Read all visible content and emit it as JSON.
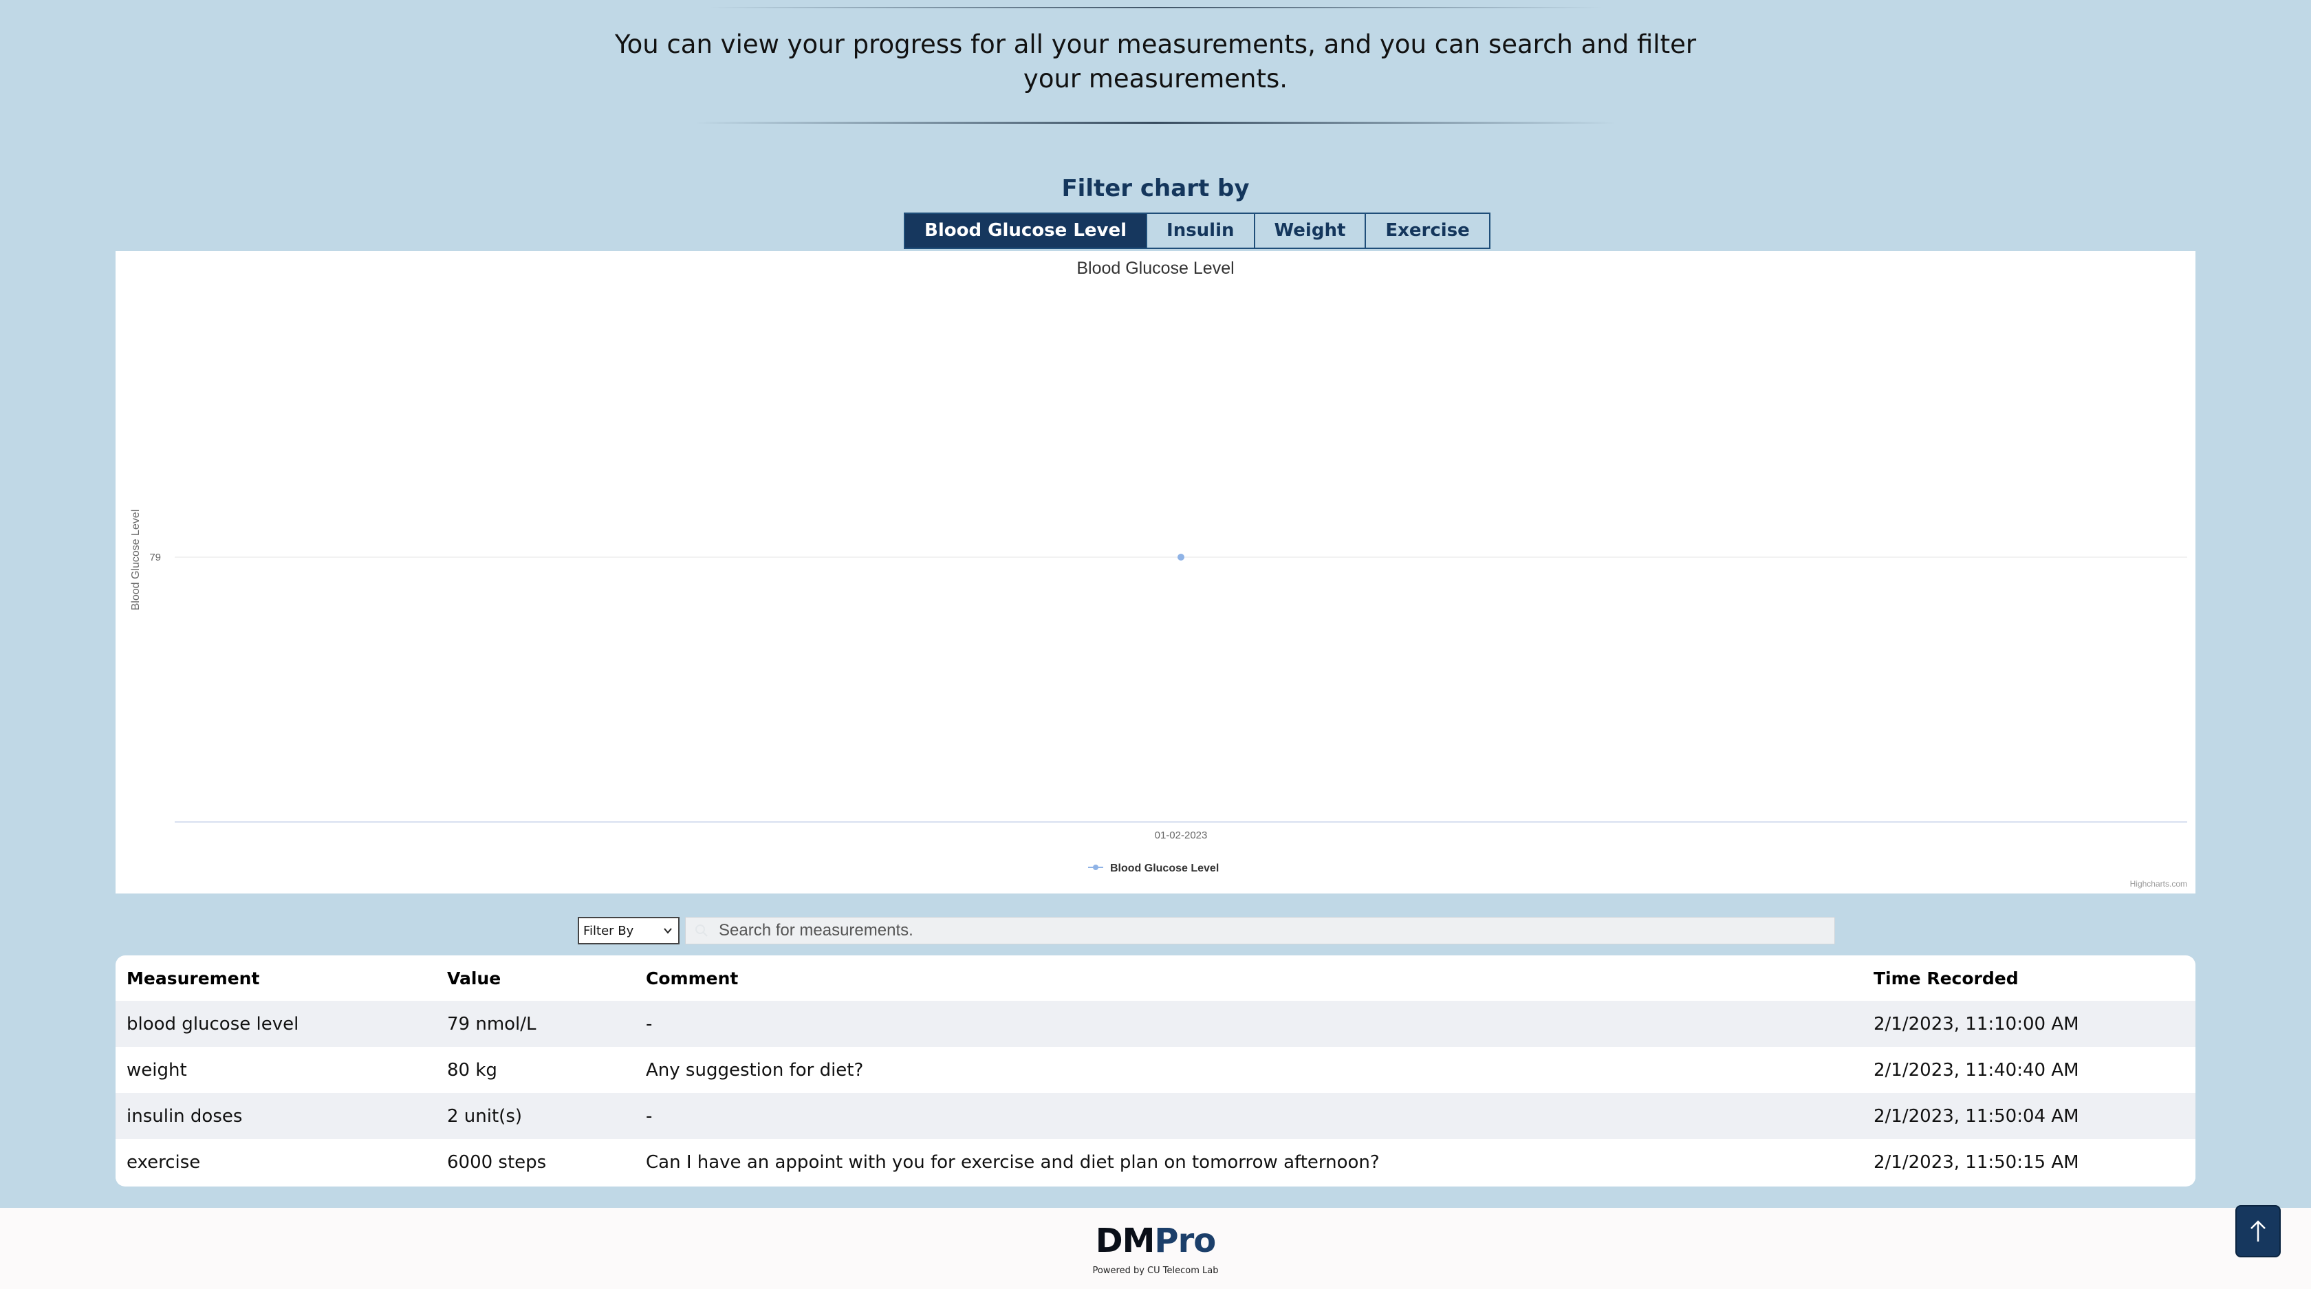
{
  "intro_text": "You can view your progress for all your measurements, and you can search and filter your measurements.",
  "filter": {
    "title": "Filter chart by",
    "tabs": [
      "Blood Glucose Level",
      "Insulin",
      "Weight",
      "Exercise"
    ],
    "active_tab": "Blood Glucose Level"
  },
  "chart_data": {
    "type": "line",
    "title": "Blood Glucose Level",
    "ylabel": "Blood Glucose Level",
    "xlabel": "",
    "x": [
      "01-02-2023"
    ],
    "series": [
      {
        "name": "Blood Glucose Level",
        "values": [
          79
        ]
      }
    ],
    "y_ticks": [
      "79"
    ],
    "legend": "bottom-center",
    "credits": "Highcharts.com",
    "series_color": "#8fb3e6"
  },
  "controls": {
    "filter_select_value": "Filter By",
    "search_placeholder": "Search for measurements."
  },
  "table": {
    "headers": [
      "Measurement",
      "Value",
      "Comment",
      "Time Recorded"
    ],
    "rows": [
      [
        "blood glucose level",
        "79 nmol/L",
        "-",
        "2/1/2023, 11:10:00 AM"
      ],
      [
        "weight",
        "80 kg",
        "Any suggestion for diet?",
        "2/1/2023, 11:40:40 AM"
      ],
      [
        "insulin doses",
        "2 unit(s)",
        "-",
        "2/1/2023, 11:50:04 AM"
      ],
      [
        "exercise",
        "6000 steps",
        "Can I have an appoint with you for exercise and diet plan on tomorrow afternoon?",
        "2/1/2023, 11:50:15 AM"
      ]
    ]
  },
  "footer": {
    "brand_dm": "DM",
    "brand_pro": "Pro",
    "powered_by": "Powered by CU Telecom Lab"
  },
  "icons": {
    "scroll_top": "arrow-up-icon",
    "search": "search-icon",
    "select": "chevron-down-icon"
  }
}
